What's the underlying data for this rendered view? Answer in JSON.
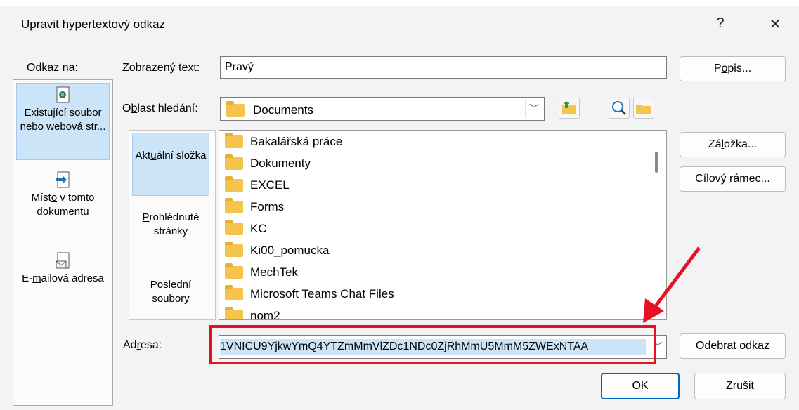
{
  "window": {
    "title": "Upravit hypertextový odkaz",
    "help": "?",
    "close": "✕"
  },
  "sidebar": {
    "label": "Odkaz na:",
    "items": [
      {
        "label_pre": "E",
        "label_u": "x",
        "label_post": "istující soubor nebo webová str...",
        "icon": "web-page-icon"
      },
      {
        "label_pre": "Míst",
        "label_u": "o",
        "label_post": " v tomto dokumentu",
        "icon": "document-place-icon"
      },
      {
        "label_pre": "E-",
        "label_u": "m",
        "label_post": "ailová adresa",
        "icon": "email-icon"
      }
    ]
  },
  "display_text": {
    "label_pre": "",
    "label_u": "Z",
    "label_post": "obrazený text:",
    "value": "Pravý"
  },
  "screen_tip_button": {
    "pre": "P",
    "u": "o",
    "post": "pis..."
  },
  "lookin": {
    "label_pre": "O",
    "label_u": "b",
    "label_post": "last hledání:",
    "value": "Documents"
  },
  "inner_sidebar": [
    {
      "pre": "Akt",
      "u": "u",
      "post": "ální složka"
    },
    {
      "pre": "",
      "u": "P",
      "post": "rohlédnuté stránky"
    },
    {
      "pre": "Posle",
      "u": "d",
      "post": "ní soubory"
    }
  ],
  "files": [
    "Bakalářská práce",
    "Dokumenty",
    "EXCEL",
    "Forms",
    "KC",
    "Ki00_pomucka",
    "MechTek",
    "Microsoft Teams Chat Files",
    "nom2"
  ],
  "right_buttons": {
    "bookmark": {
      "pre": "Zá",
      "u": "l",
      "post": "ožka..."
    },
    "target_frame": {
      "pre": "",
      "u": "C",
      "post": "ílový rámec..."
    },
    "remove_link": {
      "pre": "Od",
      "u": "e",
      "post": "brat odkaz"
    }
  },
  "address": {
    "label_pre": "Ad",
    "label_u": "r",
    "label_post": "esa:",
    "value": "1VNICU9YjkwYmQ4YTZmMmVlZDc1NDc0ZjRhMmU5MmM5ZWExNTAA"
  },
  "ok": "OK",
  "cancel": "Zrušit",
  "colors": {
    "highlight": "#e81123",
    "selection": "#cce4f7",
    "text_selection": "#0078d7"
  }
}
